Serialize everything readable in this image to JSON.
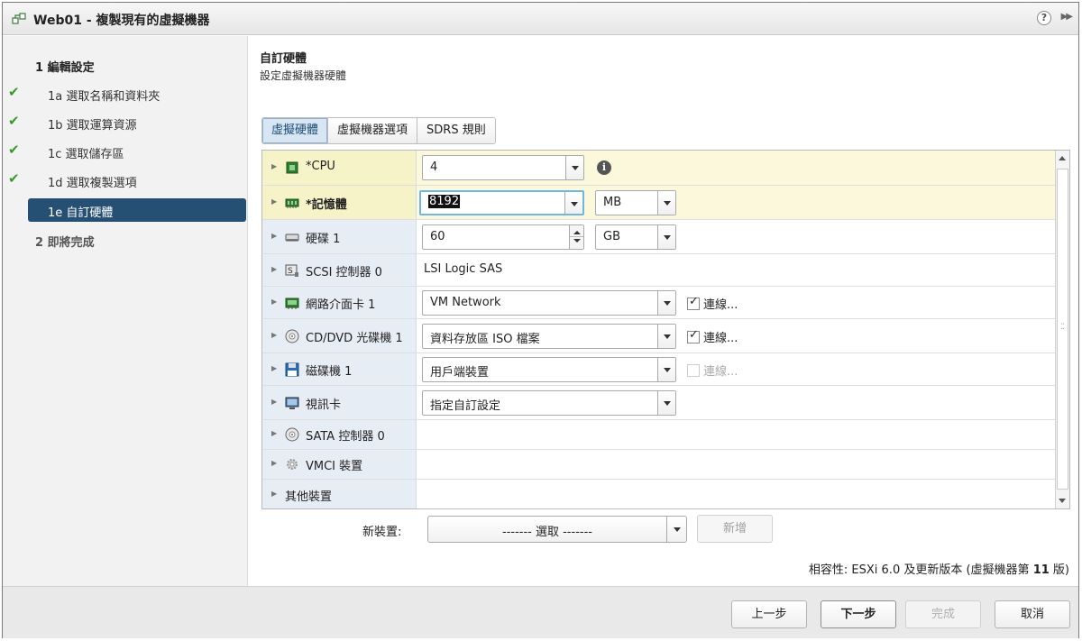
{
  "window": {
    "title": "Web01 - 複製現有的虛擬機器",
    "help_label": "?",
    "expand_label": "▶▶"
  },
  "wizard_nav": {
    "items": [
      {
        "label": "1 編輯設定",
        "completed": false,
        "active": false
      },
      {
        "label": "1a 選取名稱和資料夾",
        "completed": true,
        "active": false
      },
      {
        "label": "1b 選取運算資源",
        "completed": true,
        "active": false
      },
      {
        "label": "1c 選取儲存區",
        "completed": true,
        "active": false
      },
      {
        "label": "1d 選取複製選項",
        "completed": true,
        "active": false
      },
      {
        "label": "1e 自訂硬體",
        "completed": false,
        "active": true
      },
      {
        "label": "2 即將完成",
        "completed": false,
        "active": false
      }
    ]
  },
  "page": {
    "title": "自訂硬體",
    "subtitle": "設定虛擬機器硬體"
  },
  "tabs": [
    {
      "label": "虛擬硬體",
      "selected": true
    },
    {
      "label": "虛擬機器選項",
      "selected": false
    },
    {
      "label": "SDRS 規則",
      "selected": false
    }
  ],
  "hardware": {
    "cpu": {
      "label": "*CPU",
      "value": "4"
    },
    "memory": {
      "label": "*記憶體",
      "value": "8192",
      "unit": "MB"
    },
    "disk": {
      "label": "硬碟 1",
      "value": "60",
      "unit": "GB"
    },
    "scsi": {
      "label": "SCSI 控制器 0",
      "value": "LSI Logic SAS"
    },
    "nic": {
      "label": "網路介面卡 1",
      "value": "VM Network",
      "connect_label": "連線...",
      "connected": true
    },
    "cdrom": {
      "label": "CD/DVD 光碟機 1",
      "value": "資料存放區 ISO 檔案",
      "connect_label": "連線...",
      "connected": true
    },
    "floppy": {
      "label": "磁碟機 1",
      "value": "用戶端裝置",
      "connect_label": "連線...",
      "connected": false
    },
    "video": {
      "label": "視訊卡",
      "value": "指定自訂設定"
    },
    "sata": {
      "label": "SATA 控制器 0"
    },
    "vmci": {
      "label": "VMCI 裝置"
    },
    "other": {
      "label": "其他裝置"
    }
  },
  "new_device": {
    "label": "新裝置:",
    "selected": "------- 選取 -------",
    "add_label": "新增"
  },
  "compatibility": {
    "prefix": "相容性: ESXi 6.0 及更新版本 (虛擬機器第 ",
    "version": "11",
    "suffix": " 版)"
  },
  "footer": {
    "back": "上一步",
    "next": "下一步",
    "finish": "完成",
    "cancel": "取消"
  },
  "colors": {
    "nav_active": "#264f74",
    "check_green": "#3a9a2e",
    "label_column": "#e6edf4",
    "highlight_row": "#f6f3c9"
  }
}
